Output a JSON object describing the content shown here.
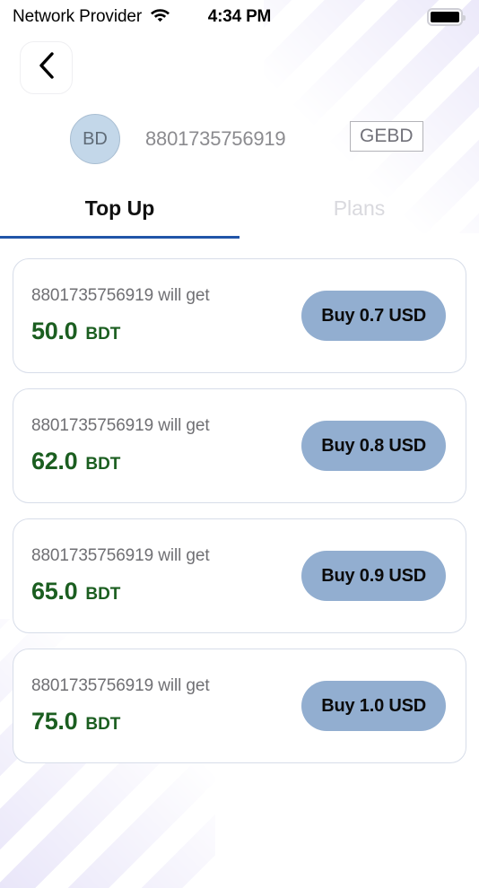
{
  "status_bar": {
    "carrier": "Network Provider",
    "time": "4:34 PM",
    "wifi_icon": "wifi-icon",
    "battery_icon": "battery-full-icon"
  },
  "nav": {
    "back_label": "",
    "back_icon": "chevron-left-icon"
  },
  "account": {
    "country_code": "BD",
    "msisdn": "8801735756919",
    "operator": "GEBD"
  },
  "tabs": [
    {
      "label": "Top Up",
      "active": true
    },
    {
      "label": "Plans",
      "active": false
    }
  ],
  "offers": [
    {
      "recipient_line": "8801735756919 will get",
      "amount": "50.0",
      "currency": "BDT",
      "buy_label": "Buy 0.7 USD"
    },
    {
      "recipient_line": "8801735756919 will get",
      "amount": "62.0",
      "currency": "BDT",
      "buy_label": "Buy 0.8 USD"
    },
    {
      "recipient_line": "8801735756919 will get",
      "amount": "65.0",
      "currency": "BDT",
      "buy_label": "Buy 0.9 USD"
    },
    {
      "recipient_line": "8801735756919 will get",
      "amount": "75.0",
      "currency": "BDT",
      "buy_label": "Buy 1.0 USD"
    }
  ],
  "colors": {
    "accent_blue": "#2155a8",
    "button_blue": "#92aed0",
    "amount_green": "#1b5e20",
    "badge_blue": "#c3d7e9",
    "deco_lavender": "#e9e6f9"
  }
}
